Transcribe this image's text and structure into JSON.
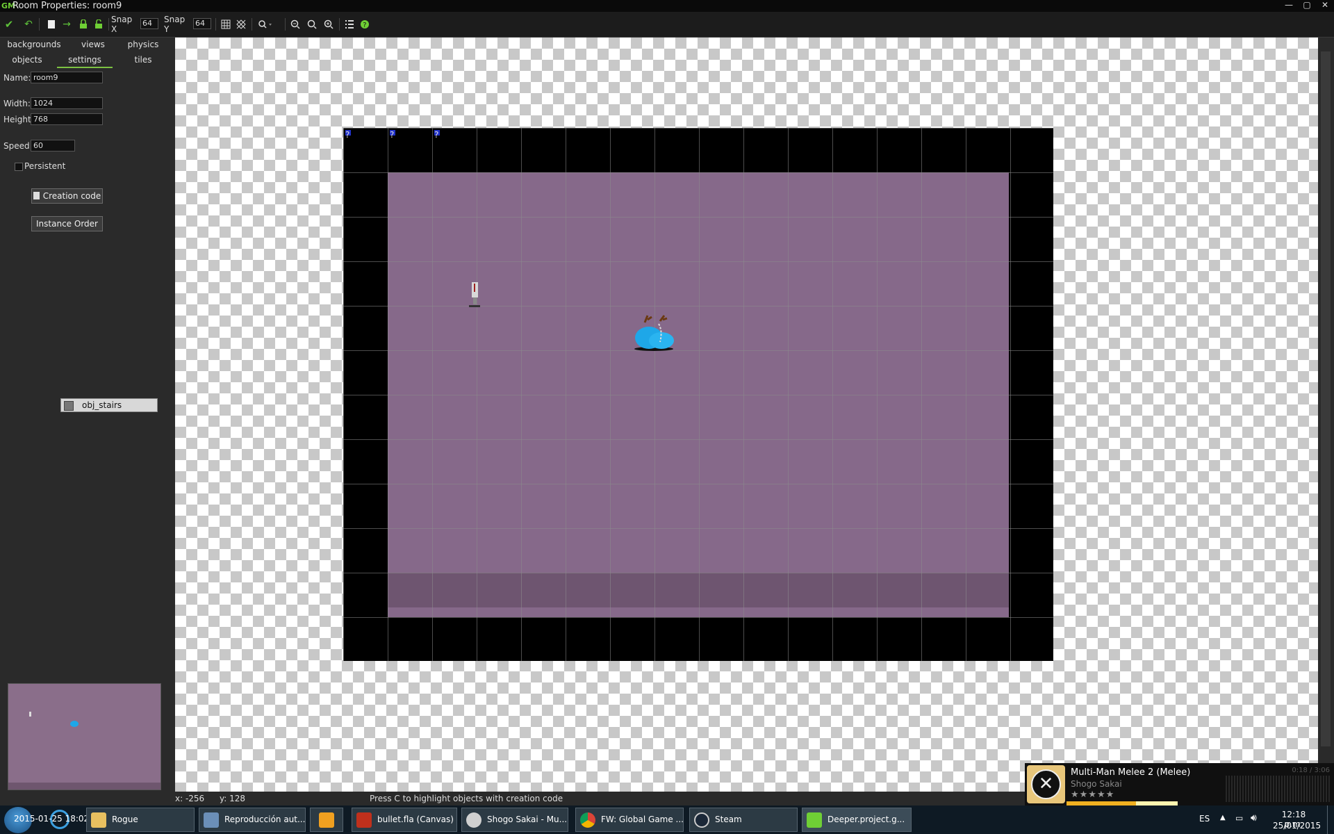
{
  "window": {
    "title": "Room Properties: room9",
    "controls": [
      "—",
      "▢",
      "✕"
    ]
  },
  "toolbar": {
    "snap_x_label": "Snap X",
    "snap_x_value": "64",
    "snap_y_label": "Snap Y",
    "snap_y_value": "64"
  },
  "tabs": {
    "backgrounds": "backgrounds",
    "views": "views",
    "physics": "physics",
    "objects": "objects",
    "settings": "settings",
    "tiles": "tiles",
    "active": "settings"
  },
  "settings": {
    "name_label": "Name:",
    "name_value": "room9",
    "width_label": "Width:",
    "width_value": "1024",
    "height_label": "Height:",
    "height_value": "768",
    "speed_label": "Speed:",
    "speed_value": "60",
    "persistent_label": "Persistent",
    "persistent_checked": false,
    "creation_code_label": "Creation code",
    "instance_order_label": "Instance Order"
  },
  "object_selector": {
    "value": "obj_stairs"
  },
  "status": {
    "x": "x: -256",
    "y": "y: 128",
    "hint": "Press C to highlight objects with creation code"
  },
  "room_marks": [
    "?",
    "?",
    "?"
  ],
  "taskbar": {
    "items": [
      {
        "label": "Rogue",
        "icon": "folder-icon"
      },
      {
        "label": "Reproducción aut...",
        "icon": "media-icon"
      },
      {
        "label": "",
        "icon": "player-icon"
      },
      {
        "label": "bullet.fla (Canvas)",
        "icon": "flash-icon"
      },
      {
        "label": "Shogo Sakai - Mu...",
        "icon": "music-icon"
      },
      {
        "label": "FW: Global Game ...",
        "icon": "chrome-icon"
      },
      {
        "label": "Steam",
        "icon": "steam-icon"
      },
      {
        "label": "Deeper.project.g...",
        "icon": "gamemaker-icon"
      }
    ],
    "overlay_text": "2015-01-25  18:02:0.45",
    "lang": "ES",
    "time": "12:18 p.m.",
    "date": "25/01/2015"
  },
  "media": {
    "song": "Multi-Man Melee 2 (Melee)",
    "artist": "Shogo Sakai",
    "time": "0:18 / 3:06",
    "rating": "★★★★★"
  },
  "colors": {
    "accent": "#7dc242",
    "floor": "#86698a",
    "wall": "#000000"
  }
}
